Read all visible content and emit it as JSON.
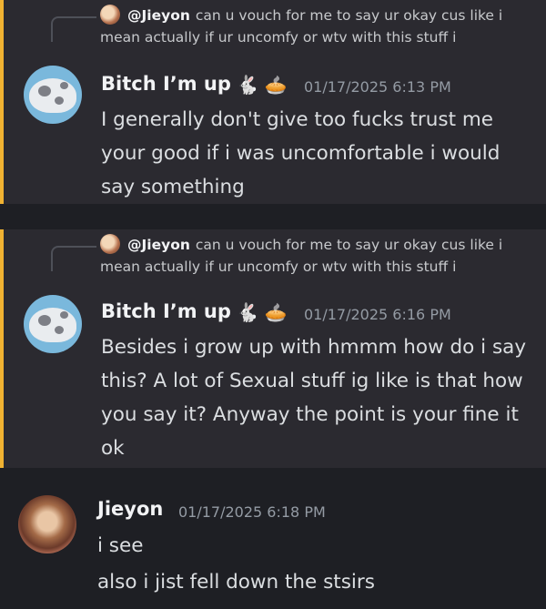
{
  "messages": [
    {
      "reply": {
        "mention": "@Jieyon",
        "text": "can u vouch for me to say ur okay cus like i mean actually if ur uncomfy or wtv with this stuff i"
      },
      "author": "Bitch I’m up",
      "badges": [
        "rabbit-icon",
        "pie-icon"
      ],
      "timestamp": "01/17/2025 6:13 PM",
      "lines": [
        "I generally don't give too fucks trust me your good if i was uncomfortable i would say something"
      ]
    },
    {
      "reply": {
        "mention": "@Jieyon",
        "text": "can u vouch for me to say ur okay cus like i mean actually if ur uncomfy or wtv with this stuff i"
      },
      "author": "Bitch I’m up",
      "badges": [
        "rabbit-icon",
        "pie-icon"
      ],
      "timestamp": "01/17/2025 6:16 PM",
      "lines": [
        "Besides i grow up with hmmm how do i say this? A lot of Sexual stuff ig like is that how you say it? Anyway the point is your fine it ok"
      ]
    },
    {
      "author": "Jieyon",
      "timestamp": "01/17/2025 6:18 PM",
      "lines": [
        "i see",
        "also i jist fell down the stsirs"
      ]
    }
  ],
  "colors": {
    "background": "#1e1f24",
    "highlight_background": "#2b2a30",
    "highlight_bar": "#f0b232",
    "text": "#dbdee1",
    "muted": "#949ba4"
  }
}
